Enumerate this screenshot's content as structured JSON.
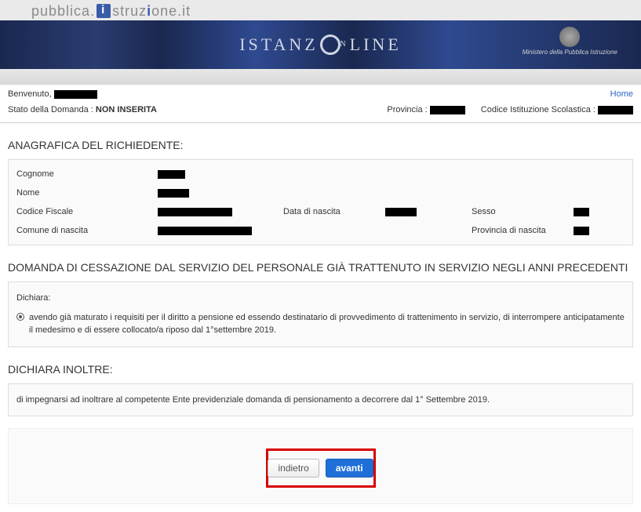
{
  "site": {
    "name_part1": "pubblica",
    "name_part2": "struz",
    "name_part3": "one",
    "tld": ".it",
    "banner_title_pre": "ISTANZ",
    "banner_title_post": "LINE",
    "ministry": "Ministero della Pubblica Istruzione"
  },
  "topbar": {
    "welcome_label": "Benvenuto,",
    "home_link": "Home"
  },
  "status": {
    "state_label": "Stato della Domanda :",
    "state_value": "NON INSERITA",
    "province_label": "Provincia :",
    "school_code_label": "Codice Istituzione Scolastica :"
  },
  "anagrafica": {
    "title": "ANAGRAFICA DEL RICHIEDENTE:",
    "cognome_label": "Cognome",
    "nome_label": "Nome",
    "cf_label": "Codice Fiscale",
    "dob_label": "Data di nascita",
    "sesso_label": "Sesso",
    "comune_label": "Comune di nascita",
    "provnasc_label": "Provincia di nascita"
  },
  "domanda": {
    "title": "DOMANDA DI CESSAZIONE DAL SERVIZIO DEL PERSONALE GIÀ TRATTENUTO IN SERVIZIO NEGLI ANNI PRECEDENTI",
    "dichiara_label": "Dichiara:",
    "option1": "avendo già maturato i requisiti per il diritto a pensione ed essendo destinatario di provvedimento di trattenimento in servizio, di interrompere anticipatamente il medesimo e di essere collocato/a riposo dal 1°settembre 2019."
  },
  "inoltre": {
    "title": "DICHIARA INOLTRE:",
    "text": "di impegnarsi ad inoltrare al competente Ente previdenziale domanda di pensionamento a decorrere dal 1° Settembre 2019."
  },
  "buttons": {
    "back": "indietro",
    "next": "avanti"
  }
}
